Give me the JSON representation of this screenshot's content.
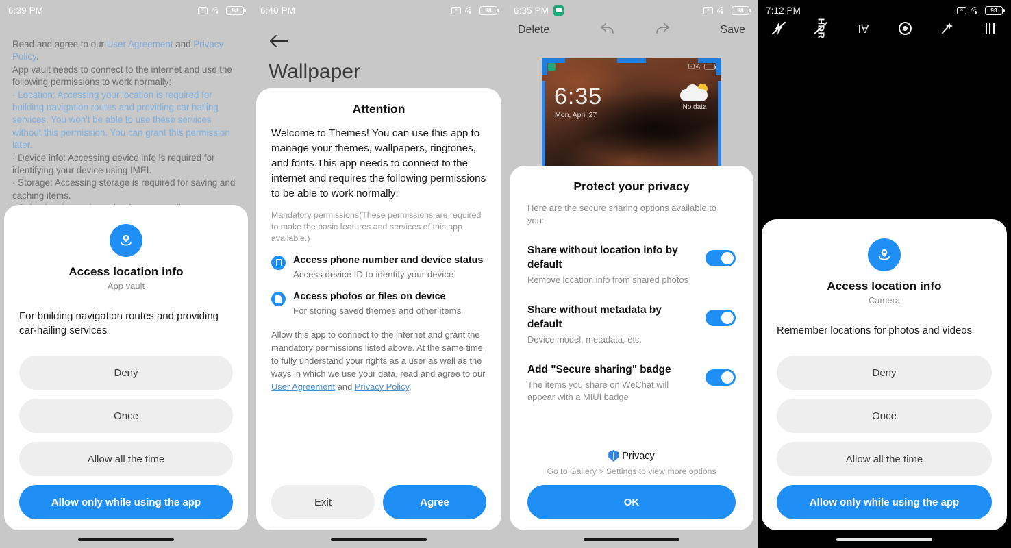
{
  "panels": {
    "app_vault": {
      "status": {
        "time": "6:39 PM",
        "battery": "98"
      },
      "background_text": {
        "l1_pre": "Read and agree to our ",
        "l1_link1": "User Agreement",
        "l1_mid": " and ",
        "l1_link2": "Privacy Policy",
        "l1_post": ".",
        "l2": "App vault needs to connect to the internet and use the following permissions to work normally:",
        "b1": " · Location: Accessing your location is required for building navigation routes and providing car hailing services. You won't be able to use these services without this permission. You can grant this permission later.",
        "b2": " · Device info: Accessing device info is required for identifying your device using IMEI.",
        "b3": " · Storage: Accessing storage is required for saving and caching items.",
        "b4": " · Calendar: Accessing calendar events allows to"
      },
      "sheet": {
        "title": "Access location info",
        "subtitle": "App vault",
        "description": "For building navigation routes and providing car-hailing services",
        "buttons": [
          "Deny",
          "Once",
          "Allow all the time",
          "Allow only while using the app"
        ]
      }
    },
    "themes": {
      "status": {
        "time": "6:40 PM",
        "battery": "98"
      },
      "page_title": "Wallpaper",
      "dialog": {
        "title": "Attention",
        "intro": "Welcome to Themes! You can use this app to manage your themes, wallpapers, ringtones, and fonts.This app needs to connect to the internet and requires the following permissions to be able to work normally:",
        "note": "Mandatory permissions(These permissions are required to make the basic features and services of this app available.)",
        "permissions": [
          {
            "name": "Access phone number and device status",
            "desc": "Access device ID to identify your device",
            "icon": "phone-icon"
          },
          {
            "name": "Access photos or files on device",
            "desc": "For storing saved themes and other items",
            "icon": "file-icon"
          }
        ],
        "footer_pre": "Allow this app to connect to the internet and grant the mandatory permissions listed above. At the same time, to fully understand your rights as a user as well as the ways in which we use your data, read and agree to our ",
        "footer_link1": "User Agreement",
        "footer_mid": " and ",
        "footer_link2": "Privacy Policy",
        "footer_post": ".",
        "exit_label": "Exit",
        "agree_label": "Agree"
      }
    },
    "gallery": {
      "status": {
        "time": "6:35 PM",
        "battery": "98"
      },
      "toolbar": {
        "delete_label": "Delete",
        "undo_icon": "undo-icon",
        "redo_icon": "redo-icon",
        "save_label": "Save"
      },
      "wallpaper_preview": {
        "time": "6:35",
        "date": "Mon, April 27",
        "weather": "No data"
      },
      "dialog": {
        "title": "Protect your privacy",
        "subtitle": "Here are the secure sharing options available to you:",
        "options": [
          {
            "label": "Share without location info by default",
            "desc": "Remove location info from shared photos",
            "on": true
          },
          {
            "label": "Share without metadata by default",
            "desc": "Device model, metadata, etc.",
            "on": true
          },
          {
            "label": "Add \"Secure sharing\" badge",
            "desc": "The items you share on WeChat will appear with a MIUI badge",
            "on": true
          }
        ],
        "brand": "Privacy",
        "hint": "Go to Gallery > Settings to view more options",
        "ok_label": "OK"
      }
    },
    "camera": {
      "status": {
        "time": "7:12 PM",
        "battery": "93"
      },
      "toolbar_icons": [
        "flash-off-icon",
        "hdr-off-icon",
        "ai-icon",
        "aperture-icon",
        "magic-wand-icon",
        "menu-icon"
      ],
      "hdr_label": "HDR",
      "ai_label": "AI",
      "sheet": {
        "title": "Access location info",
        "subtitle": "Camera",
        "description": "Remember locations for photos and videos",
        "buttons": [
          "Deny",
          "Once",
          "Allow all the time",
          "Allow only while using the app"
        ]
      }
    }
  },
  "colors": {
    "accent": "#1f8ff5",
    "sheet_bg": "#ffffff",
    "panel_bg": "#c8c8c8",
    "link": "#7fa9d8"
  }
}
